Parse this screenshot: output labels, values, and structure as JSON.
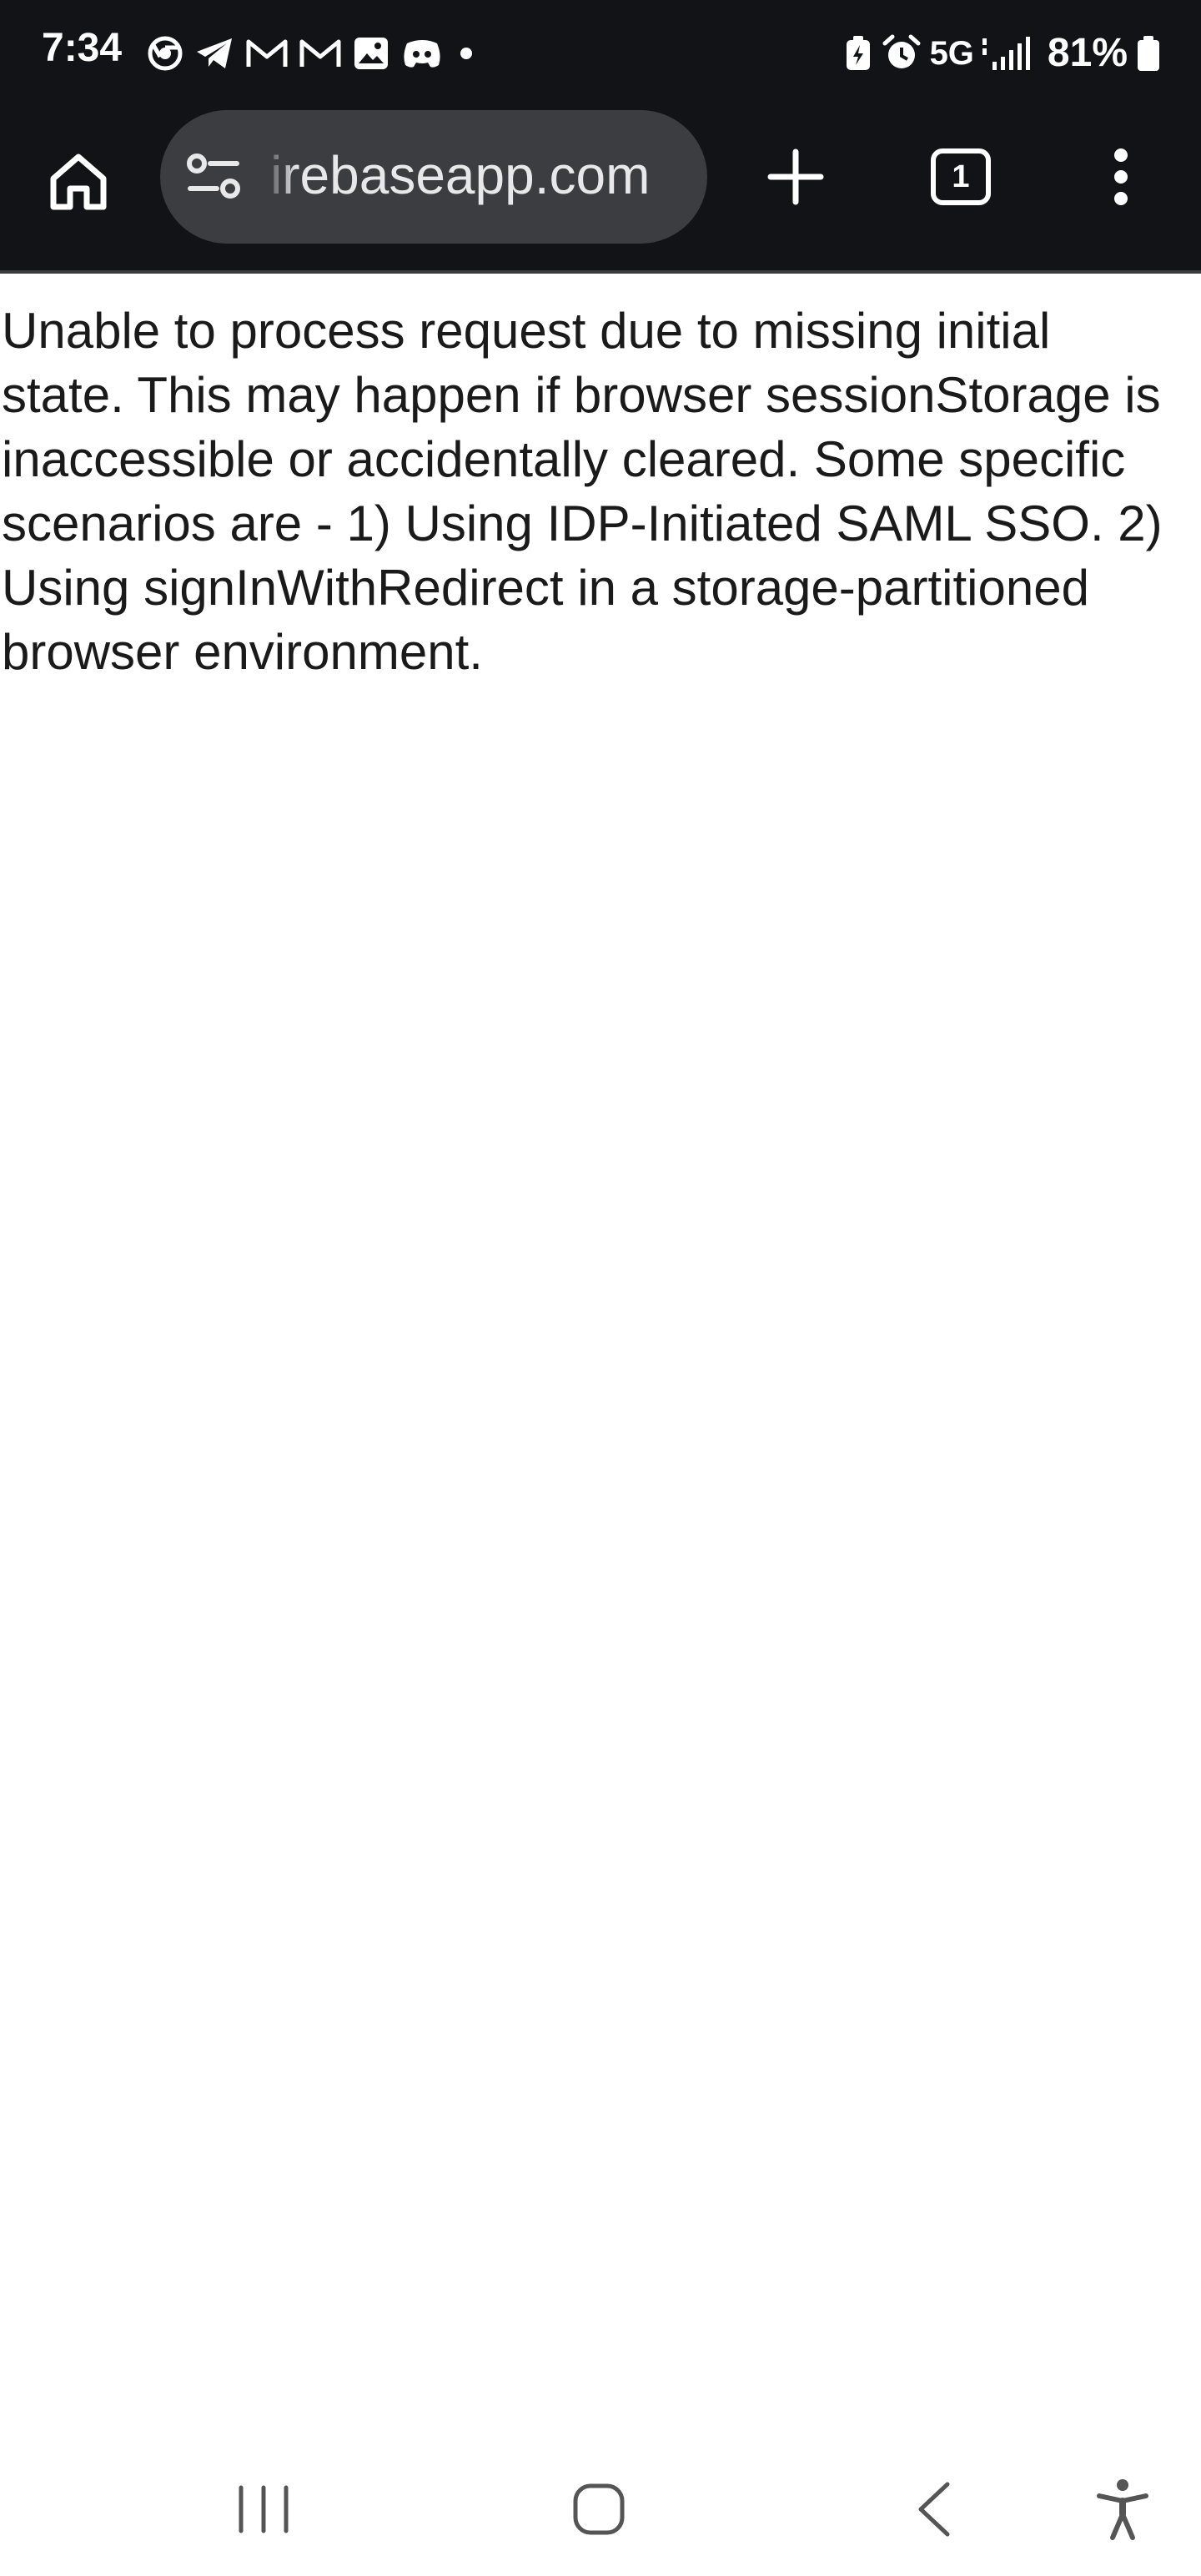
{
  "status_bar": {
    "time": "7:34",
    "notification_icons": [
      "chrome-icon",
      "telegram-icon",
      "gmail-icon",
      "gmail-icon",
      "gallery-icon",
      "discord-icon",
      "more-dot-icon"
    ],
    "network": "5G",
    "battery_percent": "81%",
    "status_icons": [
      "battery-saver-icon",
      "alarm-icon",
      "signal-icon",
      "battery-icon"
    ]
  },
  "browser": {
    "url": "irebaseapp.com",
    "tab_count": "1"
  },
  "page": {
    "message": "Unable to process request due to missing initial state. This may happen if browser sessionStorage is inaccessible or accidentally cleared. Some specific scenarios are - 1) Using IDP-Initiated SAML SSO. 2) Using signInWithRedirect in a storage-partitioned browser environment."
  },
  "nav_bar": {
    "buttons": [
      "recent-apps-icon",
      "home-icon",
      "back-icon",
      "accessibility-icon"
    ]
  },
  "colors": {
    "chrome_dark": "#121316",
    "omnibox": "#3c3d40",
    "text": "#1a1a1a",
    "nav_icon": "#555555"
  }
}
